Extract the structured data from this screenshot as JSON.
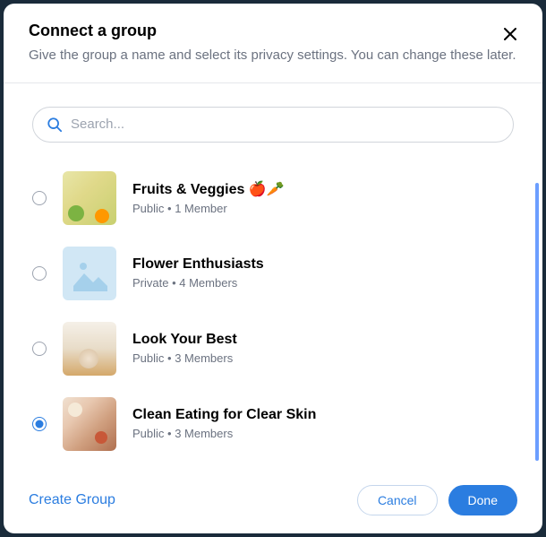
{
  "header": {
    "title": "Connect a group",
    "subtitle": "Give the group a name and select its privacy settings. You can change these later."
  },
  "search": {
    "placeholder": "Search..."
  },
  "groups": [
    {
      "name": "Fruits & Veggies 🍎🥕",
      "privacy": "Public",
      "members": "1 Member",
      "selected": false,
      "thumb": "fruits"
    },
    {
      "name": "Flower Enthusiasts",
      "privacy": "Private",
      "members": "4 Members",
      "selected": false,
      "thumb": "placeholder"
    },
    {
      "name": "Look Your Best",
      "privacy": "Public",
      "members": "3 Members",
      "selected": false,
      "thumb": "look"
    },
    {
      "name": "Clean Eating for Clear Skin",
      "privacy": "Public",
      "members": "3 Members",
      "selected": true,
      "thumb": "clean"
    }
  ],
  "meta_separator": "   •   ",
  "footer": {
    "create": "Create Group",
    "cancel": "Cancel",
    "done": "Done"
  }
}
